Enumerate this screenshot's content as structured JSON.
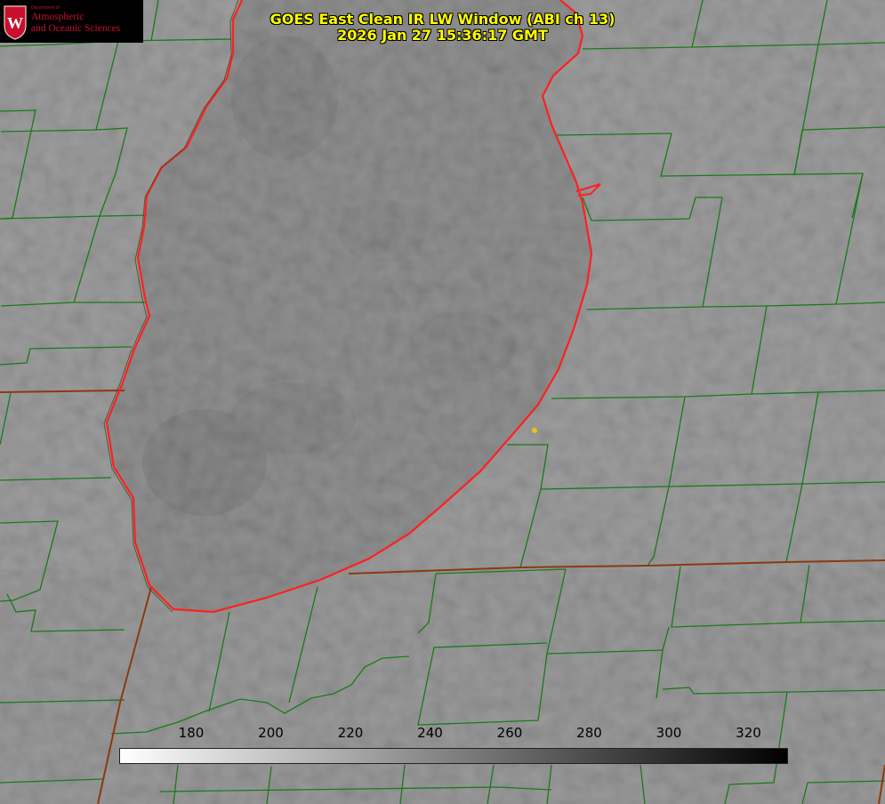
{
  "header": {
    "title": "GOES East Clean IR LW Window (ABI ch 13)",
    "timestamp": "2026 Jan 27 15:36:17 GMT"
  },
  "logo": {
    "badge_letter": "W",
    "department": "Department of",
    "line1": "Atmospheric",
    "line2": "and Oceanic Sciences"
  },
  "colorbar": {
    "ticks": [
      "180",
      "200",
      "220",
      "240",
      "260",
      "280",
      "300",
      "320"
    ],
    "gradient_start": "#ffffff",
    "gradient_end": "#000000"
  },
  "colors": {
    "title": "#ffff00",
    "state_borders": "#8b3a10",
    "county_borders": "#1a7a1a",
    "shoreline": "#ff2020",
    "marker": "#e8c800",
    "logo_text": "#c8102e",
    "logo_bg": "#000000"
  }
}
